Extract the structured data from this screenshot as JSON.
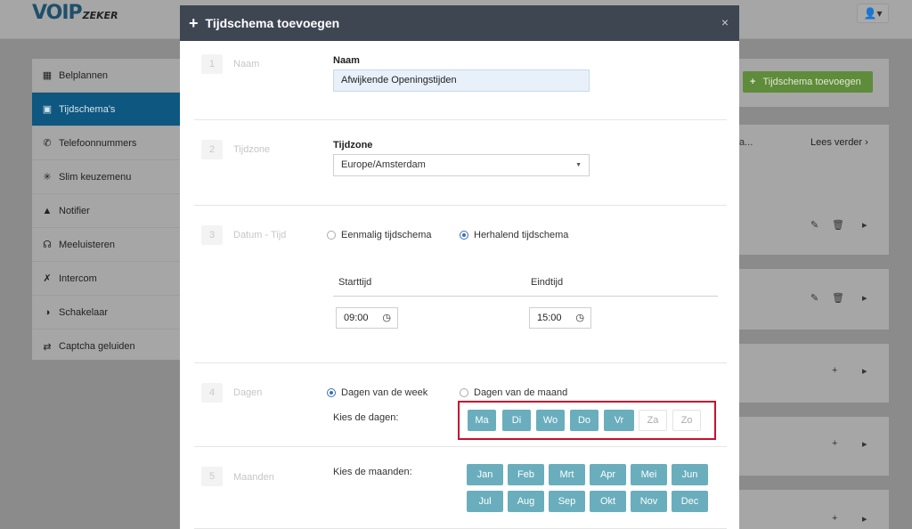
{
  "app": {
    "logo_main": "VOIP",
    "logo_sub": "ZEKER",
    "user_icon": "user-icon"
  },
  "sidebar": {
    "items": [
      {
        "label": "Belplannen",
        "icon": "sitemap-icon"
      },
      {
        "label": "Tijdschema's",
        "icon": "calendar-icon",
        "active": true
      },
      {
        "label": "Telefoonnummers",
        "icon": "phone-icon"
      },
      {
        "label": "Slim keuzemenu",
        "icon": "network-icon"
      },
      {
        "label": "Notifier",
        "icon": "bullhorn-icon"
      },
      {
        "label": "Meeluisteren",
        "icon": "headphones-icon"
      },
      {
        "label": "Intercom",
        "icon": "phone-slash-icon"
      },
      {
        "label": "Schakelaar",
        "icon": "toggle-icon"
      },
      {
        "label": "Captcha geluiden",
        "icon": "shuffle-icon"
      }
    ]
  },
  "background": {
    "add_button_label": "Tijdschema toevoegen",
    "truncated_header": "a...",
    "lees_verder": "Lees verder"
  },
  "modal": {
    "title": "Tijdschema toevoegen",
    "close": "×",
    "steps": {
      "naam": {
        "num": "1",
        "label": "Naam",
        "field_label": "Naam",
        "value": "Afwijkende Openingstijden"
      },
      "tijdzone": {
        "num": "2",
        "label": "Tijdzone",
        "field_label": "Tijdzone",
        "value": "Europe/Amsterdam"
      },
      "datum": {
        "num": "3",
        "label": "Datum - Tijd",
        "option_once": "Eenmalig tijdschema",
        "option_repeat": "Herhalend tijdschema",
        "start_label": "Starttijd",
        "end_label": "Eindtijd",
        "start_value": "09:00",
        "end_value": "15:00"
      },
      "dagen": {
        "num": "4",
        "label": "Dagen",
        "option_week": "Dagen van de week",
        "option_month": "Dagen van de maand",
        "prompt": "Kies de dagen:",
        "days": [
          {
            "label": "Ma",
            "selected": true
          },
          {
            "label": "Di",
            "selected": true
          },
          {
            "label": "Wo",
            "selected": true
          },
          {
            "label": "Do",
            "selected": true
          },
          {
            "label": "Vr",
            "selected": true
          },
          {
            "label": "Za",
            "selected": false
          },
          {
            "label": "Zo",
            "selected": false
          }
        ]
      },
      "maanden": {
        "num": "5",
        "label": "Maanden",
        "prompt": "Kies de maanden:",
        "months": [
          "Jan",
          "Feb",
          "Mrt",
          "Apr",
          "Mei",
          "Jun",
          "Jul",
          "Aug",
          "Sep",
          "Okt",
          "Nov",
          "Dec"
        ]
      }
    }
  },
  "colors": {
    "accent": "#6aaebd",
    "header": "#3e4652",
    "highlight": "#c8102e",
    "nav_active": "#0d5780"
  }
}
